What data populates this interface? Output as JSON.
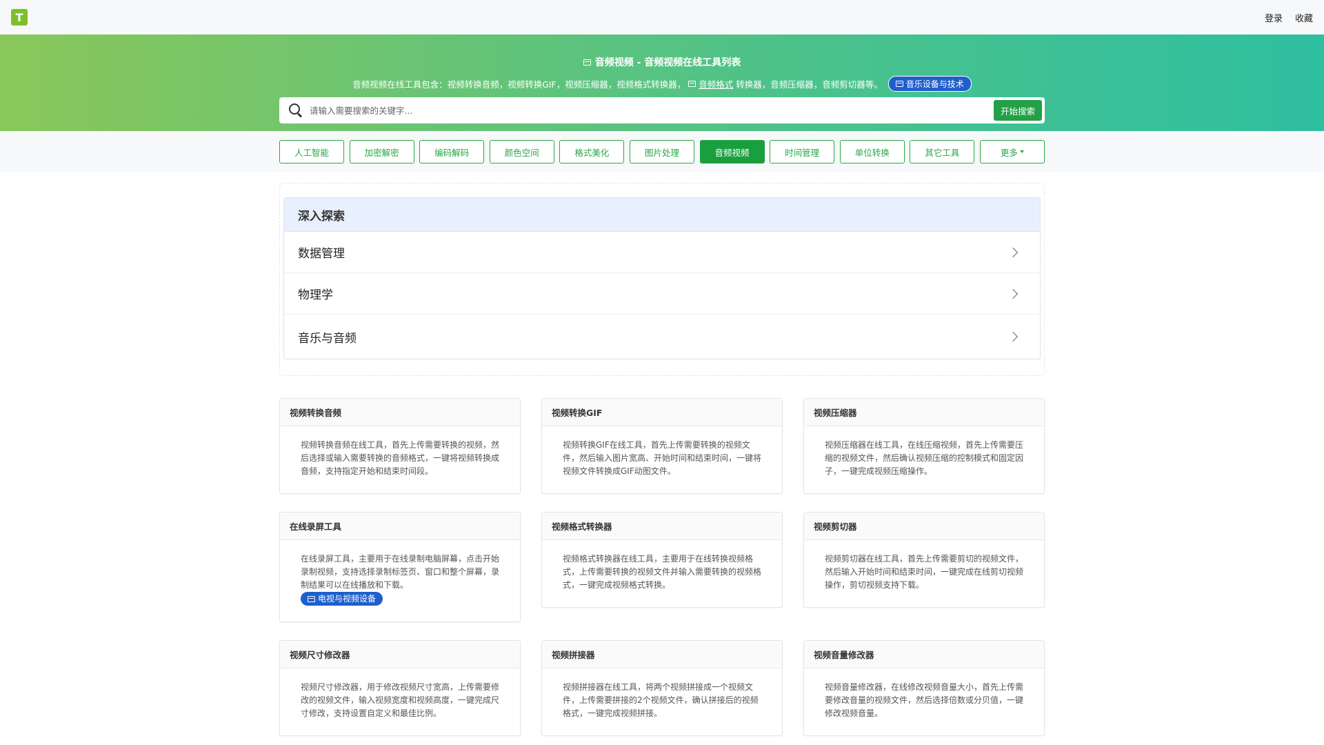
{
  "topbar": {
    "logo_text": "T",
    "nav": [
      "登录",
      "收藏"
    ]
  },
  "hero": {
    "title": "音频视频 - 音频视频在线工具列表",
    "desc_before": "音频视频在线工具包含：视频转换音频，视频转换GIF，视频压缩器，视频格式转换器，",
    "desc_link": "音频格式",
    "desc_after": "转换器，音频压缩器，音频剪切器等。",
    "tag": "音乐设备与技术"
  },
  "search": {
    "placeholder": "请输入需要搜索的关键字...",
    "button": "开始搜索"
  },
  "categories": [
    {
      "label": "人工智能",
      "active": false
    },
    {
      "label": "加密解密",
      "active": false
    },
    {
      "label": "编码解码",
      "active": false
    },
    {
      "label": "颜色空间",
      "active": false
    },
    {
      "label": "格式美化",
      "active": false
    },
    {
      "label": "图片处理",
      "active": false
    },
    {
      "label": "音频视频",
      "active": true
    },
    {
      "label": "时间管理",
      "active": false
    },
    {
      "label": "单位转换",
      "active": false
    },
    {
      "label": "其它工具",
      "active": false
    },
    {
      "label": "更多",
      "active": false,
      "dropdown": true
    }
  ],
  "explore": {
    "heading": "深入探索",
    "items": [
      "数据管理",
      "物理学",
      "音乐与音频"
    ]
  },
  "cards": [
    {
      "title": "视频转换音频",
      "desc": "视频转换音频在线工具，首先上传需要转换的视频，然后选择或输入需要转换的音频格式，一键将视频转换成音频，支持指定开始和结束时间段。"
    },
    {
      "title": "视频转换GIF",
      "desc": "视频转换GIF在线工具，首先上传需要转换的视频文件，然后输入图片宽高、开始时间和结束时间，一键将视频文件转换成GIF动图文件。"
    },
    {
      "title": "视频压缩器",
      "desc": "视频压缩器在线工具，在线压缩视频，首先上传需要压缩的视频文件，然后确认视频压缩的控制模式和固定因子，一键完成视频压缩操作。"
    },
    {
      "title": "在线录屏工具",
      "desc": "在线录屏工具，主要用于在线录制电脑屏幕，点击开始录制视频，支持选择录制标签页、窗口和整个屏幕，录制结果可以在线播放和下载。",
      "tag": "电视与视频设备"
    },
    {
      "title": "视频格式转换器",
      "desc": "视频格式转换器在线工具，主要用于在线转换视频格式，上传需要转换的视频文件并输入需要转换的视频格式，一键完成视频格式转换。"
    },
    {
      "title": "视频剪切器",
      "desc": "视频剪切器在线工具，首先上传需要剪切的视频文件，然后输入开始时间和结束时间，一键完成在线剪切视频操作，剪切视频支持下载。"
    },
    {
      "title": "视频尺寸修改器",
      "desc": "视频尺寸修改器，用于修改视频尺寸宽高，上传需要修改的视频文件，输入视频宽度和视频高度，一键完成尺寸修改，支持设置自定义和最佳比例。"
    },
    {
      "title": "视频拼接器",
      "desc": "视频拼接器在线工具，将两个视频拼接成一个视频文件，上传需要拼接的2个视频文件，确认拼接后的视频格式，一键完成视频拼接。"
    },
    {
      "title": "视频音量修改器",
      "desc": "视频音量修改器，在线修改视频音量大小，首先上传需要修改音量的视频文件，然后选择倍数或分贝值，一键修改视频音量。"
    }
  ]
}
